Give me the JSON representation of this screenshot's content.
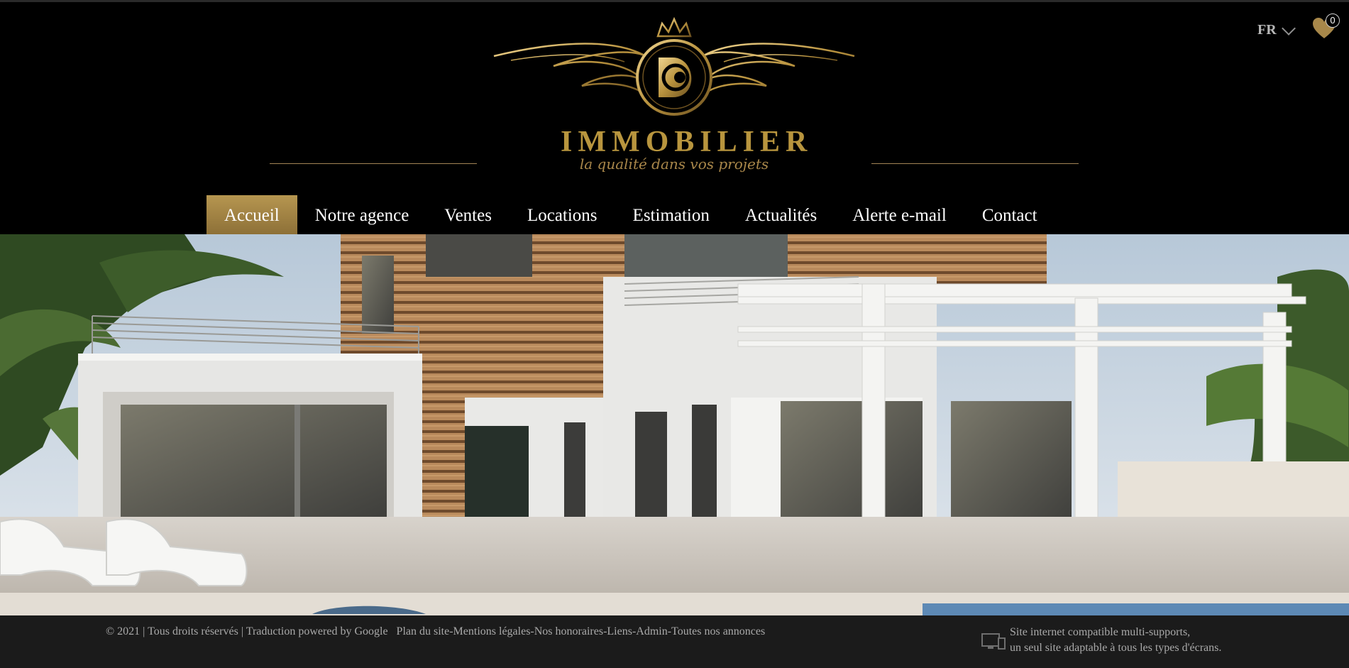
{
  "brand": {
    "logo_letter": "D",
    "name": "IMMOBILIER",
    "tagline": "la qualité dans vos projets",
    "gold": "#b8953e"
  },
  "header": {
    "language": "FR",
    "favorites_count": "0",
    "favorites_icon": "heart-icon"
  },
  "nav": {
    "items": [
      {
        "label": "Accueil",
        "active": true
      },
      {
        "label": "Notre agence"
      },
      {
        "label": "Ventes"
      },
      {
        "label": "Locations"
      },
      {
        "label": "Estimation"
      },
      {
        "label": "Actualités"
      },
      {
        "label": "Alerte e-mail"
      },
      {
        "label": "Contact"
      }
    ]
  },
  "footer": {
    "copyright": "© 2021 | Tous droits réservés | Traduction powered by Google",
    "links": [
      "Plan du site",
      "Mentions légales",
      "Nos honoraires",
      "Liens",
      "Admin",
      "Toutes nos annonces"
    ],
    "separator": "-",
    "compat_line1": "Site internet compatible multi-supports,",
    "compat_line2": "un seul site adaptable à tous les types d'écrans."
  }
}
